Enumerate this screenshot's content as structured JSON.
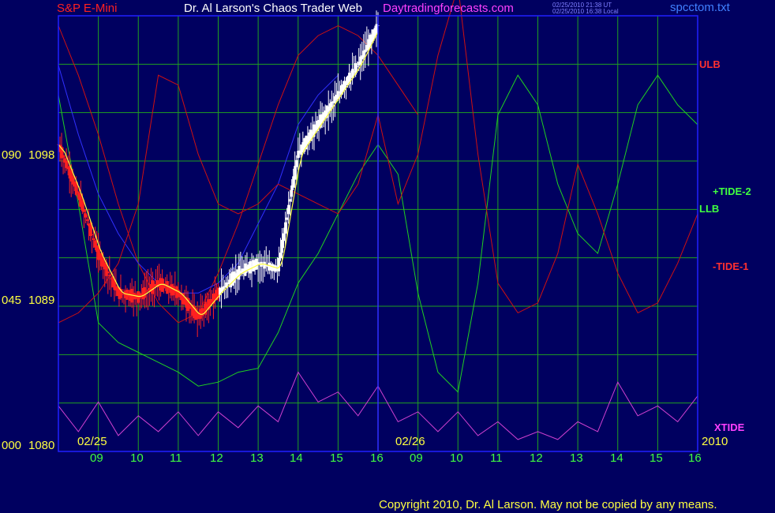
{
  "header": {
    "instrument": "S&P E-Mini",
    "title": "Dr. Al Larson's Chaos Trader Web",
    "website": "Daytradingforecasts.com",
    "timestamp_ut": "02/25/2010 21:38 UT",
    "timestamp_local": "02/25/2010 16:38 Local",
    "filename": "spcctom.txt"
  },
  "y_axis_labels": [
    {
      "left": "090",
      "right": "1098"
    },
    {
      "left": "045",
      "right": "1089"
    },
    {
      "left": "000",
      "right": "1080"
    }
  ],
  "x_axis": {
    "date_labels": [
      "02/25",
      "02/26"
    ],
    "year_label": "2010",
    "hour_ticks": [
      "09",
      "10",
      "11",
      "12",
      "13",
      "14",
      "15",
      "16",
      "09",
      "10",
      "11",
      "12",
      "13",
      "14",
      "15",
      "16"
    ]
  },
  "right_labels": [
    {
      "text": "ULB",
      "color": "#ff3030"
    },
    {
      "text": "+TIDE-2",
      "color": "#40ff40"
    },
    {
      "text": "LLB",
      "color": "#40ff40"
    },
    {
      "text": "-TIDE-1",
      "color": "#ff3030"
    },
    {
      "text": "XTIDE",
      "color": "#ff40ff"
    }
  ],
  "footer": {
    "copyright": "Copyright 2010, Dr. Al Larson. May not be copied by any means."
  },
  "colors": {
    "background": "#000060",
    "grid": "#20a020",
    "frame": "#2020ff",
    "price": "#ffffff",
    "price_down": "#ff2020",
    "forecast_red": "#d01010",
    "forecast_green": "#20d020",
    "forecast_blue": "#3030ff",
    "xtide": "#d040d0",
    "average": "#ffff40"
  },
  "chart_data": {
    "type": "line",
    "title": "S&P E-Mini",
    "xlabel": "",
    "ylabel": "",
    "ylim": [
      1080,
      1102
    ],
    "grid": true,
    "x": [
      8.0,
      8.5,
      9.0,
      9.5,
      10.0,
      10.5,
      11.0,
      11.5,
      12.0,
      12.5,
      13.0,
      13.5,
      14.0,
      14.5,
      15.0,
      15.5,
      16.0,
      16.5,
      17.0,
      17.5,
      18.0,
      18.5,
      19.0,
      19.5,
      20.0,
      20.5,
      21.0,
      21.5,
      22.0,
      22.5,
      23.0,
      23.5,
      24.0
    ],
    "series": [
      {
        "name": "price",
        "color": "#ffffff",
        "values": [
          1095.5,
          1093.0,
          1090.0,
          1088.0,
          1087.8,
          1088.5,
          1088.0,
          1086.8,
          1088.0,
          1089.0,
          1089.5,
          1089.2,
          1095.0,
          1096.5,
          1098.0,
          1099.5,
          1101.5
        ]
      },
      {
        "name": "ULB",
        "color": "#d01010",
        "values": [
          1101.5,
          1099.0,
          1096.0,
          1092.5,
          1089.5,
          1087.5,
          1086.5,
          1087.0,
          1089.0,
          1091.5,
          1094.5,
          1097.5,
          1100.0,
          1101.0,
          1101.5,
          1101.0,
          1100.0,
          1098.5,
          1097.0
        ]
      },
      {
        "name": "LLB",
        "color": "#3030ff",
        "values": [
          1099.5,
          1096.0,
          1093.0,
          1091.0,
          1089.5,
          1088.5,
          1088.0,
          1088.0,
          1088.5,
          1089.5,
          1091.5,
          1093.5,
          1096.5,
          1098.0,
          1099.0
        ]
      },
      {
        "name": "+TIDE-2",
        "color": "#20d020",
        "values": [
          1098.0,
          1092.5,
          1086.5,
          1085.5,
          1085.0,
          1084.5,
          1084.0,
          1083.3,
          1083.5,
          1084.0,
          1084.2,
          1086.0,
          1088.5,
          1090.0,
          1092.0,
          1094.0,
          1095.5,
          1094.0,
          1088.0,
          1084.0,
          1083.0,
          1088.5,
          1097.0,
          1099.0,
          1097.5,
          1093.5,
          1091.0,
          1090.0,
          1093.5,
          1097.5,
          1099.0,
          1097.5,
          1096.5
        ]
      },
      {
        "name": "-TIDE-1",
        "color": "#d01010",
        "values": [
          1086.5,
          1087.0,
          1088.0,
          1089.5,
          1092.5,
          1099.0,
          1098.5,
          1095.0,
          1092.5,
          1092.0,
          1092.5,
          1093.5,
          1093.0,
          1092.5,
          1092.0,
          1093.5,
          1097.0,
          1092.5,
          1095.0,
          1100.0,
          1103.5,
          1095.0,
          1088.5,
          1087.0,
          1087.5,
          1090.0,
          1094.5,
          1092.0,
          1089.0,
          1087.0,
          1087.5,
          1089.5,
          1092.0
        ]
      },
      {
        "name": "XTIDE",
        "color": "#d040d0",
        "values": [
          1082.3,
          1081.0,
          1082.5,
          1080.8,
          1081.8,
          1081.0,
          1082.0,
          1080.8,
          1082.0,
          1081.2,
          1082.3,
          1081.5,
          1084.0,
          1082.5,
          1083.0,
          1081.8,
          1083.3,
          1081.5,
          1082.0,
          1081.0,
          1082.0,
          1080.8,
          1081.5,
          1080.6,
          1081.0,
          1080.6,
          1081.5,
          1081.0,
          1083.5,
          1081.8,
          1082.3,
          1081.5,
          1082.8
        ]
      }
    ]
  }
}
